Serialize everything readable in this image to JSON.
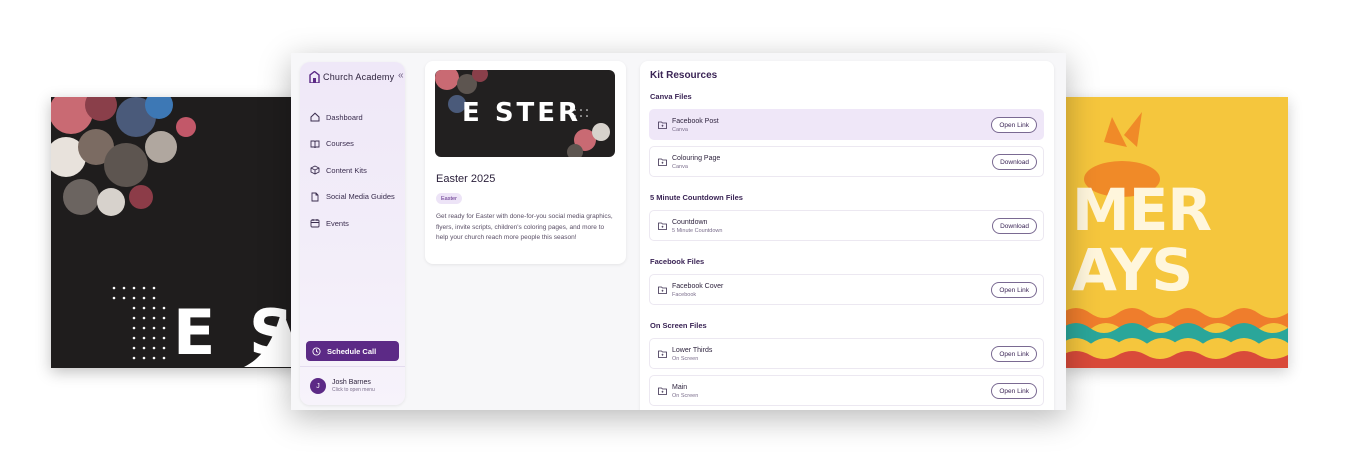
{
  "background_left": {
    "text": "E S"
  },
  "background_right": {
    "line1": "MER",
    "line2": "AYS"
  },
  "sidebar": {
    "brand": "Church Academy",
    "collapse_icon": "«",
    "items": [
      {
        "label": "Dashboard",
        "icon": "home-icon"
      },
      {
        "label": "Courses",
        "icon": "book-icon"
      },
      {
        "label": "Content Kits",
        "icon": "box-icon"
      },
      {
        "label": "Social Media Guides",
        "icon": "file-icon"
      },
      {
        "label": "Events",
        "icon": "calendar-icon"
      }
    ],
    "schedule_label": "Schedule Call",
    "user": {
      "initial": "J",
      "name": "Josh Barnes",
      "subtitle": "Click to open menu"
    }
  },
  "kit": {
    "thumb_text": "E STER",
    "title": "Easter 2025",
    "tag": "Easter",
    "description": "Get ready for Easter with done-for-you social media graphics, flyers, invite scripts, children's coloring pages, and more to help your church reach more people this season!"
  },
  "resources": {
    "title": "Kit Resources",
    "sections": [
      {
        "title": "Canva Files",
        "items": [
          {
            "name": "Facebook Post",
            "sub": "Canva",
            "action": "Open Link",
            "active": true
          },
          {
            "name": "Colouring Page",
            "sub": "Canva",
            "action": "Download",
            "active": false
          }
        ]
      },
      {
        "title": "5 Minute Countdown Files",
        "items": [
          {
            "name": "Countdown",
            "sub": "5 Minute Countdown",
            "action": "Download",
            "active": false
          }
        ]
      },
      {
        "title": "Facebook Files",
        "items": [
          {
            "name": "Facebook Cover",
            "sub": "Facebook",
            "action": "Open Link",
            "active": false
          }
        ]
      },
      {
        "title": "On Screen Files",
        "items": [
          {
            "name": "Lower Thirds",
            "sub": "On Screen",
            "action": "Open Link",
            "active": false
          },
          {
            "name": "Main",
            "sub": "On Screen",
            "action": "Open Link",
            "active": false
          }
        ]
      }
    ]
  },
  "colors": {
    "accent": "#5c2a86",
    "sidebar_bg": "#efe8f8",
    "active_row": "#efe7f8"
  }
}
